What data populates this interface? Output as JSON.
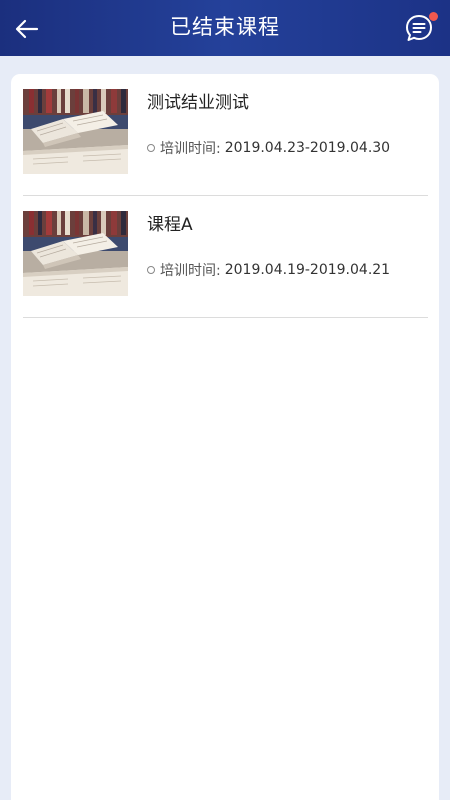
{
  "header": {
    "title": "已结束课程",
    "back_icon": "arrow-left-icon",
    "message_icon": "chat-bubble-icon",
    "background_color": "#1f388c",
    "badge_color": "#f0584e"
  },
  "courses": [
    {
      "name": "测试结业测试",
      "time_label": "培训时间:",
      "time_range": "2019.04.23-2019.04.30",
      "thumbnail_icon": "open-book-image"
    },
    {
      "name": "课程A",
      "time_label": "培训时间:",
      "time_range": "2019.04.19-2019.04.21",
      "thumbnail_icon": "open-book-image"
    }
  ]
}
